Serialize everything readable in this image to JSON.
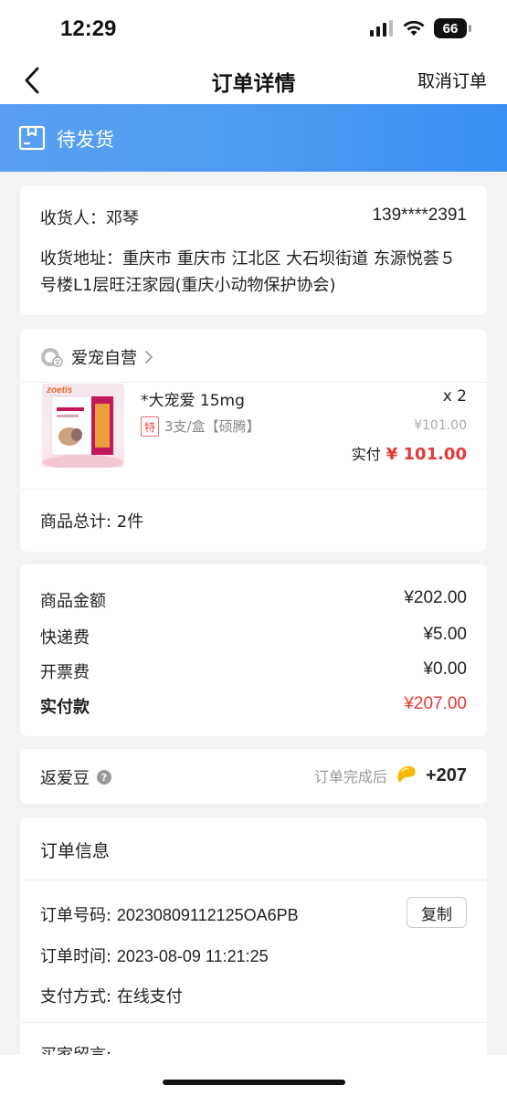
{
  "status": {
    "time": "12:29",
    "battery": "66"
  },
  "nav": {
    "title": "订单详情",
    "cancel_label": "取消订单"
  },
  "banner": {
    "status_text": "待发货"
  },
  "address": {
    "receiver_label": "收货人：",
    "receiver_name": "邓琴",
    "phone": "139****2391",
    "address_label": "收货地址：",
    "address_text": "重庆市 重庆市 江北区 大石坝街道 东源悦荟５号楼L1层旺汪家园(重庆小动物保护协会)"
  },
  "goods": {
    "shop_name": "爱宠自营",
    "product": {
      "brand": "zoetis",
      "name": "*大宠爱 15mg",
      "qty": "x 2",
      "tag": "特",
      "spec": "3支/盒【硕腾】",
      "orig_price": "¥101.00",
      "paid_label": "实付",
      "paid_value": "¥ 101.00"
    },
    "total_label": "商品总计: 2件"
  },
  "amounts": [
    {
      "label": "商品金额",
      "value": "¥202.00"
    },
    {
      "label": "快递费",
      "value": "¥5.00"
    },
    {
      "label": "开票费",
      "value": "¥0.00"
    },
    {
      "label": "实付款",
      "value": "¥207.00"
    }
  ],
  "beans": {
    "label": "返爱豆",
    "hint": "订单完成后",
    "value": "+207"
  },
  "order_info": {
    "title": "订单信息",
    "order_no_label": "订单号码:",
    "order_no": "20230809112125OA6PB",
    "copy_label": "复制",
    "time_label": "订单时间:",
    "time": "2023-08-09 11:21:25",
    "pay_label": "支付方式:",
    "pay": "在线支付",
    "buyer_msg_label": "买家留言:"
  },
  "colors": {
    "accent_blue": "#4d9bf3",
    "price_red": "#e53935"
  }
}
